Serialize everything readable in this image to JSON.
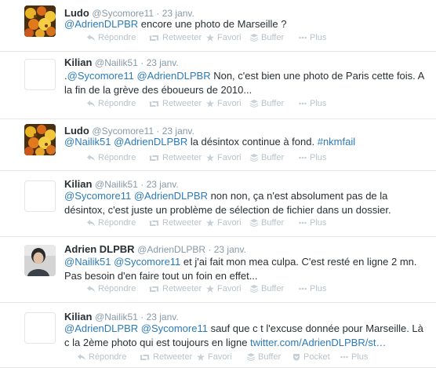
{
  "actions": {
    "reply": "Répondre",
    "retweet": "Retweeter",
    "favorite": "Favori",
    "buffer": "Buffer",
    "pocket": "Pocket",
    "more": "Plus"
  },
  "tweets": [
    {
      "fullname": "Ludo",
      "username": "@Sycomore11",
      "time": "23 janv.",
      "avatar": "flowers-photo",
      "text": [
        {
          "t": "mention",
          "v": "@AdrienDLPBR"
        },
        {
          "t": "text",
          "v": " encore une photo de Marseille ?"
        }
      ]
    },
    {
      "fullname": "Kilian",
      "username": "@Nailik51",
      "time": "23 janv.",
      "avatar": "blank",
      "text": [
        {
          "t": "text",
          "v": "."
        },
        {
          "t": "mention",
          "v": "@Sycomore11"
        },
        {
          "t": "text",
          "v": " "
        },
        {
          "t": "mention",
          "v": "@AdrienDLPBR"
        },
        {
          "t": "text",
          "v": " Non, c'est bien une photo de Paris cette fois. A la fin de la grève des éboueurs de 2010..."
        }
      ]
    },
    {
      "fullname": "Ludo",
      "username": "@Sycomore11",
      "time": "23 janv.",
      "avatar": "flowers-photo",
      "text": [
        {
          "t": "mention",
          "v": "@Nailik51"
        },
        {
          "t": "text",
          "v": " "
        },
        {
          "t": "mention",
          "v": "@AdrienDLPBR"
        },
        {
          "t": "text",
          "v": " la désintox continue à fond. "
        },
        {
          "t": "hashtag",
          "v": "#nkmfail"
        }
      ]
    },
    {
      "fullname": "Kilian",
      "username": "@Nailik51",
      "time": "23 janv.",
      "avatar": "blank",
      "text": [
        {
          "t": "mention",
          "v": "@Sycomore11"
        },
        {
          "t": "text",
          "v": " "
        },
        {
          "t": "mention",
          "v": "@AdrienDLPBR"
        },
        {
          "t": "text",
          "v": " non non, ça n'est absolument pas de la désintox, c'est juste un problème de sélection de fichier dans un dossier."
        }
      ]
    },
    {
      "fullname": "Adrien DLPBR",
      "username": "@AdrienDLPBR",
      "time": "23 janv.",
      "avatar": "person-photo",
      "text": [
        {
          "t": "mention",
          "v": "@Nailik51"
        },
        {
          "t": "text",
          "v": " "
        },
        {
          "t": "mention",
          "v": "@Sycomore11"
        },
        {
          "t": "text",
          "v": " et j'ai fait mon mea culpa. C'est resté en ligne 2 mn. Pas besoin d'en faire tout un foin en effet..."
        }
      ]
    },
    {
      "fullname": "Kilian",
      "username": "@Nailik51",
      "time": "23 janv.",
      "avatar": "blank",
      "show_pocket": true,
      "text": [
        {
          "t": "mention",
          "v": "@AdrienDLPBR"
        },
        {
          "t": "text",
          "v": " "
        },
        {
          "t": "mention",
          "v": "@Sycomore11"
        },
        {
          "t": "text",
          "v": " sauf que c t l'excuse donnée pour Marseille. Là c la 2ème photo qui est toujours en ligne "
        },
        {
          "t": "link",
          "v": "twitter.com/AdrienDLPBR/st…"
        }
      ]
    }
  ]
}
